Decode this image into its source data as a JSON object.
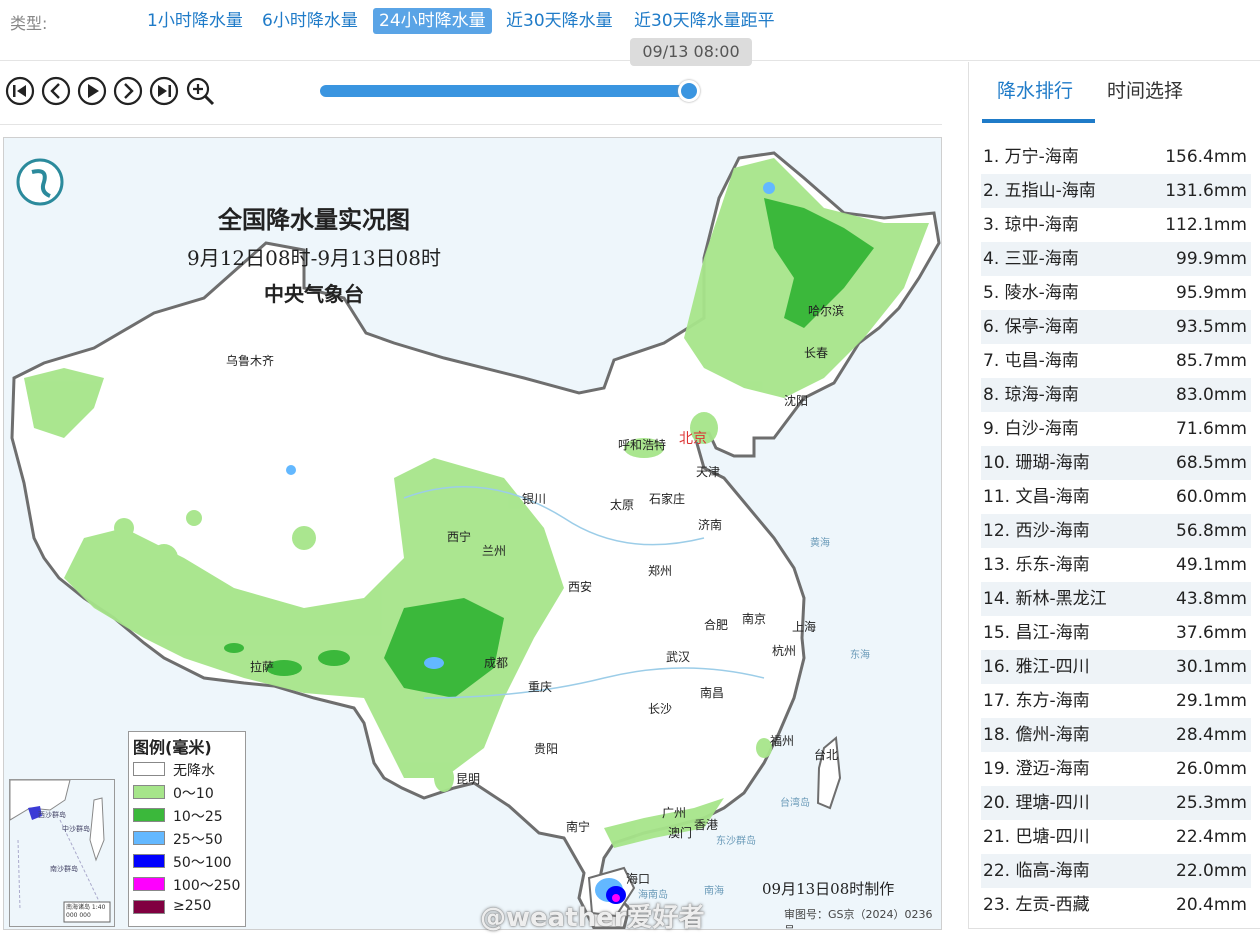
{
  "type_bar": {
    "label": "类型:",
    "tabs": [
      {
        "label": "1小时降水量",
        "active": false
      },
      {
        "label": "6小时降水量",
        "active": false
      },
      {
        "label": "24小时降水量",
        "active": true
      },
      {
        "label": "近30天降水量",
        "active": false
      },
      {
        "label": "近30天降水量距平",
        "active": false
      }
    ],
    "time_tip": "09/13 08:00"
  },
  "player": {
    "controls": [
      "first-frame-icon",
      "previous-icon",
      "play-icon",
      "next-icon",
      "last-frame-icon",
      "zoom-in-icon"
    ],
    "progress": 1.0,
    "accent_color": "#3a95e0"
  },
  "map": {
    "title": "全国降水量实况图",
    "subtitle": "9月12日08时-9月13日08时",
    "agency": "中央气象台",
    "made_time": "09月13日08时制作",
    "approval": "审图号：GS京（2024）0236号",
    "watermark": "@weather爱好者",
    "legend": {
      "title": "图例(毫米)",
      "items": [
        {
          "label": "无降水",
          "color": "#ffffff"
        },
        {
          "label": "0～10",
          "color": "#a6e58a"
        },
        {
          "label": "10～25",
          "color": "#3bb83b"
        },
        {
          "label": "25～50",
          "color": "#63b8ff"
        },
        {
          "label": "50～100",
          "color": "#0000fe"
        },
        {
          "label": "100～250",
          "color": "#fe00fe"
        },
        {
          "label": "≥250",
          "color": "#800040"
        }
      ]
    },
    "cities": {
      "wulumuqi": "乌鲁木齐",
      "haerbin": "哈尔滨",
      "changchun": "长春",
      "shenyang": "沈阳",
      "huhehaote": "呼和浩特",
      "beijing": "北京",
      "tianjin": "天津",
      "yinchuan": "银川",
      "taiyuan": "太原",
      "shijiazhuang": "石家庄",
      "jinan": "济南",
      "xining": "西宁",
      "lanzhou": "兰州",
      "zhengzhou": "郑州",
      "xian": "西安",
      "hefei": "合肥",
      "nanjing": "南京",
      "shanghai": "上海",
      "lasa": "拉萨",
      "chengdu": "成都",
      "wuhan": "武汉",
      "hangzhou": "杭州",
      "chongqing": "重庆",
      "nanchang": "南昌",
      "changsha": "长沙",
      "guiyang": "贵阳",
      "fuzhou": "福州",
      "taibei": "台北",
      "kunming": "昆明",
      "guangzhou": "广州",
      "aomen": "澳门",
      "xianggang": "香港",
      "nanning": "南宁",
      "haikou": "海口"
    },
    "seas": {
      "huanghai": "黄海",
      "donghai": "东海",
      "dongsha": "东沙群岛",
      "taiwan": "台湾岛",
      "hainan": "海南岛",
      "nanhai": "南海"
    },
    "inset_labels": {
      "a": "西沙群岛",
      "b": "中沙群岛",
      "c": "南沙群岛",
      "scale": "南海诸岛 1:40 000 000"
    }
  },
  "panel": {
    "tabs": [
      {
        "label": "降水排行",
        "active": true
      },
      {
        "label": "时间选择",
        "active": false
      }
    ],
    "ranking": [
      {
        "name": "1. 万宁-海南",
        "value": "156.4mm"
      },
      {
        "name": "2. 五指山-海南",
        "value": "131.6mm"
      },
      {
        "name": "3. 琼中-海南",
        "value": "112.1mm"
      },
      {
        "name": "4. 三亚-海南",
        "value": "99.9mm"
      },
      {
        "name": "5. 陵水-海南",
        "value": "95.9mm"
      },
      {
        "name": "6. 保亭-海南",
        "value": "93.5mm"
      },
      {
        "name": "7. 屯昌-海南",
        "value": "85.7mm"
      },
      {
        "name": "8. 琼海-海南",
        "value": "83.0mm"
      },
      {
        "name": "9. 白沙-海南",
        "value": "71.6mm"
      },
      {
        "name": "10. 珊瑚-海南",
        "value": "68.5mm"
      },
      {
        "name": "11. 文昌-海南",
        "value": "60.0mm"
      },
      {
        "name": "12. 西沙-海南",
        "value": "56.8mm"
      },
      {
        "name": "13. 乐东-海南",
        "value": "49.1mm"
      },
      {
        "name": "14. 新林-黑龙江",
        "value": "43.8mm"
      },
      {
        "name": "15. 昌江-海南",
        "value": "37.6mm"
      },
      {
        "name": "16. 雅江-四川",
        "value": "30.1mm"
      },
      {
        "name": "17. 东方-海南",
        "value": "29.1mm"
      },
      {
        "name": "18. 儋州-海南",
        "value": "28.4mm"
      },
      {
        "name": "19. 澄迈-海南",
        "value": "26.0mm"
      },
      {
        "name": "20. 理塘-四川",
        "value": "25.3mm"
      },
      {
        "name": "21. 巴塘-四川",
        "value": "22.4mm"
      },
      {
        "name": "22. 临高-海南",
        "value": "22.0mm"
      },
      {
        "name": "23. 左贡-西藏",
        "value": "20.4mm"
      }
    ]
  }
}
